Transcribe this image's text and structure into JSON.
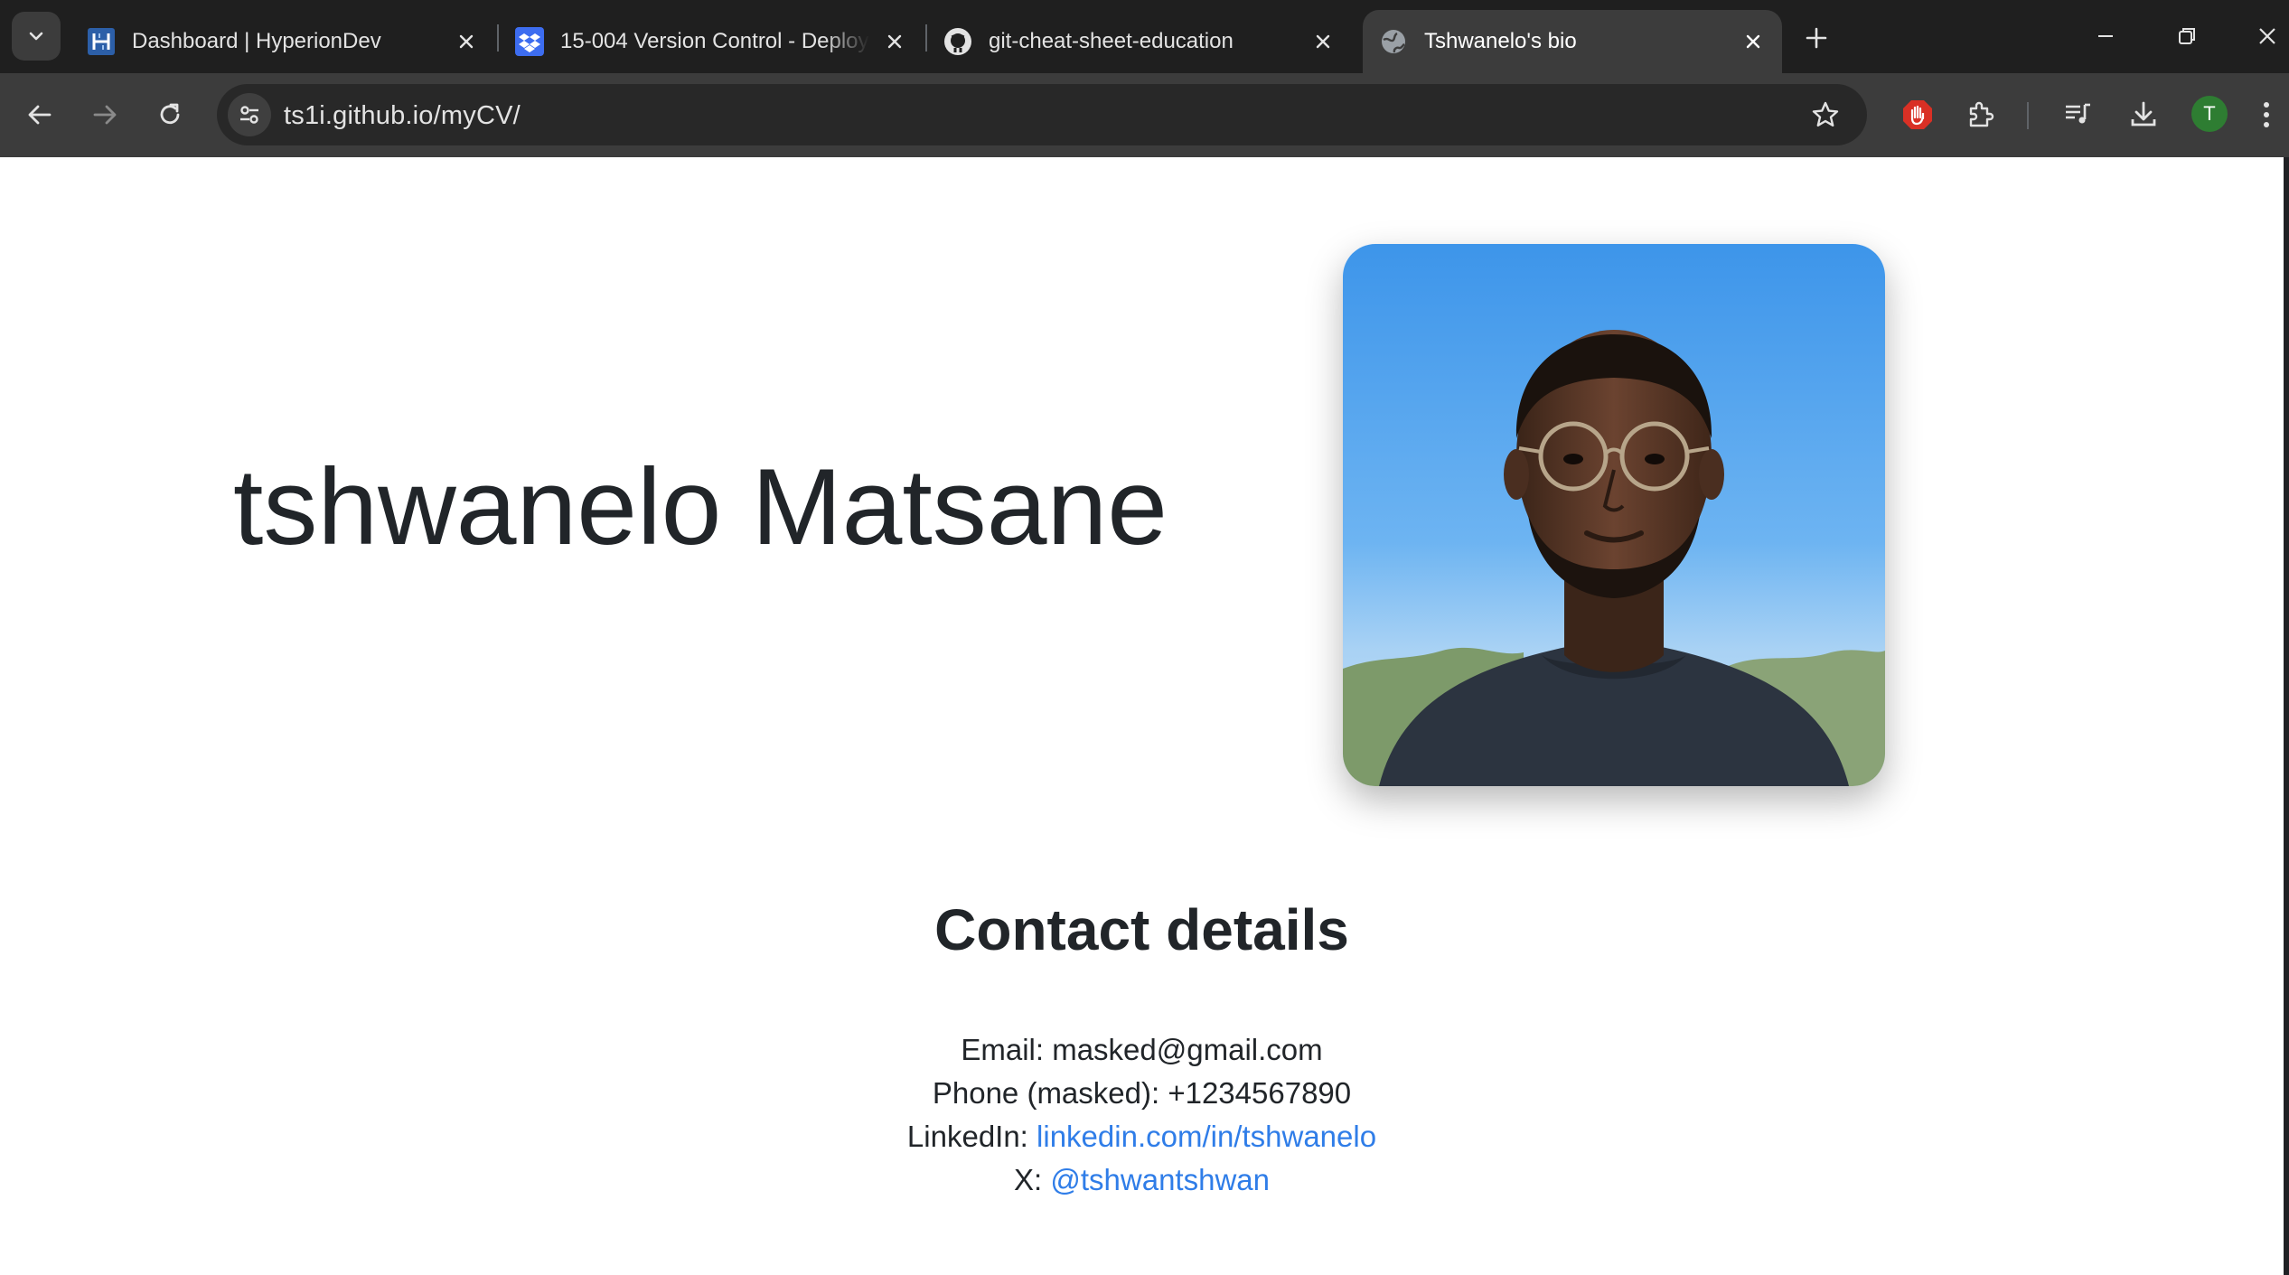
{
  "browser": {
    "tabs": [
      {
        "title": "Dashboard | HyperionDev",
        "favicon": "hyperiondev-icon",
        "active": false
      },
      {
        "title": "15-004 Version Control - Deploy",
        "favicon": "dropbox-icon",
        "active": false
      },
      {
        "title": "git-cheat-sheet-education",
        "favicon": "github-icon",
        "active": false
      },
      {
        "title": "Tshwanelo's bio",
        "favicon": "globe-icon",
        "active": true
      }
    ],
    "url": "ts1i.github.io/myCV/",
    "profile_initial": "T"
  },
  "page": {
    "name": "tshwanelo Matsane",
    "contact": {
      "heading": "Contact details",
      "email_label": "Email:",
      "email_value": "masked@gmail.com",
      "phone_label": "Phone (masked):",
      "phone_value": "+1234567890",
      "linkedin_label": "LinkedIn:",
      "linkedin_link": "linkedin.com/in/tshwanelo",
      "x_label": "X:",
      "x_link": "@tshwantshwan"
    }
  },
  "colors": {
    "link": "#2f7de8",
    "text": "#212529",
    "chrome_bg": "#1f1f1f",
    "toolbar_bg": "#3c3c3c"
  }
}
